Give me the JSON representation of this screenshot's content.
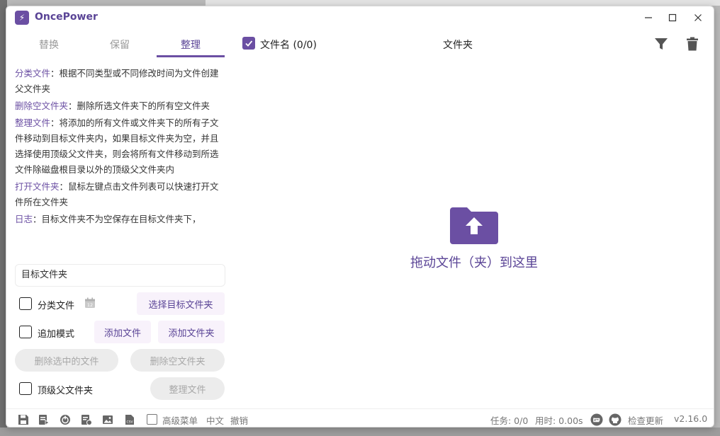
{
  "app": {
    "title": "OncePower"
  },
  "tabs": [
    {
      "label": "替换"
    },
    {
      "label": "保留"
    },
    {
      "label": "整理"
    }
  ],
  "descriptions": [
    {
      "key": "分类文件",
      "text": "：根据不同类型或不同修改时间为文件创建父文件夹"
    },
    {
      "key": "删除空文件夹",
      "text": "：删除所选文件夹下的所有空文件夹"
    },
    {
      "key": "整理文件",
      "text": "：将添加的所有文件或文件夹下的所有子文件移动到目标文件夹内，如果目标文件夹为空，并且选择使用顶级父文件夹，则会将所有文件移动到所选文件除磁盘根目录以外的顶级父文件夹内"
    },
    {
      "key": "打开文件夹",
      "text": "：鼠标左键点击文件列表可以快速打开文件所在文件夹"
    },
    {
      "key": "日志",
      "text": "：目标文件夹不为空保存在目标文件夹下，"
    }
  ],
  "form": {
    "target_placeholder": "目标文件夹",
    "classify_label": "分类文件",
    "select_target_label": "选择目标文件夹",
    "append_label": "追加模式",
    "add_file_label": "添加文件",
    "add_folder_label": "添加文件夹",
    "delete_selected_label": "删除选中的文件",
    "delete_empty_label": "删除空文件夹",
    "top_parent_label": "顶级父文件夹",
    "organize_label": "整理文件"
  },
  "main": {
    "col_name": "文件名 (0/0)",
    "col_folder": "文件夹",
    "drop_text": "拖动文件（夹）到这里"
  },
  "status": {
    "advanced_menu": "高级菜单",
    "language": "中文",
    "undo": "撤销",
    "tasks": "任务: 0/0",
    "time": "用时: 0.00s",
    "check_update": "检查更新",
    "version": "v2.16.0"
  },
  "colors": {
    "accent": "#6b4fa3",
    "accent_light": "#f8f2fb"
  }
}
